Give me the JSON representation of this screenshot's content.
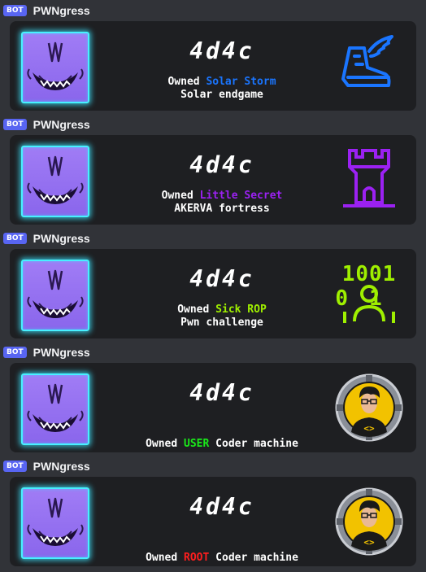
{
  "messages": [
    {
      "bot_tag": "BOT",
      "author": "PWNgress",
      "logo_text": "4d4c",
      "line1_prefix": "Owned ",
      "highlight": "Solar Storm",
      "highlight_color": "#1a75ff",
      "line1_suffix": "",
      "line2": "Solar endgame",
      "icon": "winged-boot-icon"
    },
    {
      "bot_tag": "BOT",
      "author": "PWNgress",
      "logo_text": "4d4c",
      "line1_prefix": "Owned ",
      "highlight": "Little Secret",
      "highlight_color": "#9b21f2",
      "line1_suffix": "",
      "line2": "AKERVA fortress",
      "icon": "castle-tower-icon"
    },
    {
      "bot_tag": "BOT",
      "author": "PWNgress",
      "logo_text": "4d4c",
      "line1_prefix": "Owned ",
      "highlight": "Sick ROP",
      "highlight_color": "#9fef00",
      "line1_suffix": "",
      "line2": "Pwn challenge",
      "icon": "binary-user-icon",
      "icon_digits_top": "1001",
      "icon_digits_mid": "01"
    },
    {
      "bot_tag": "BOT",
      "author": "PWNgress",
      "logo_text": "4d4c",
      "line1_prefix": "Owned ",
      "highlight": "USER",
      "highlight_color": "#1aeb1a",
      "line1_suffix": " Coder machine",
      "line2": "",
      "icon": "coder-machine-avatar-icon",
      "icon_code_glyph": "<>"
    },
    {
      "bot_tag": "BOT",
      "author": "PWNgress",
      "logo_text": "4d4c",
      "line1_prefix": "Owned ",
      "highlight": "ROOT",
      "highlight_color": "#ff1e1e",
      "line1_suffix": " Coder machine",
      "line2": "",
      "icon": "coder-machine-avatar-icon",
      "icon_code_glyph": "<>"
    }
  ]
}
